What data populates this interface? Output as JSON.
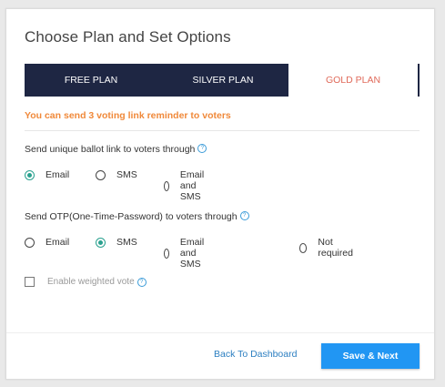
{
  "dialog": {
    "title": "Choose Plan and Set Options"
  },
  "plans": {
    "tabs": [
      {
        "label": "FREE PLAN"
      },
      {
        "label": "SILVER PLAN"
      },
      {
        "label": "GOLD PLAN"
      }
    ],
    "selected": "GOLD PLAN"
  },
  "notice": "You can send 3 voting link reminder to voters",
  "ballot": {
    "label": "Send unique ballot link to voters through",
    "help_icon": "help-circle-icon",
    "options": [
      "Email",
      "SMS",
      "Email and SMS"
    ],
    "selected": "Email"
  },
  "otp": {
    "label": "Send OTP(One-Time-Password) to voters through",
    "help_icon": "help-circle-icon",
    "options": [
      "Email",
      "SMS",
      "Email and SMS",
      "Not required"
    ],
    "selected": "SMS"
  },
  "weighted": {
    "label": "Enable weighted vote",
    "checked": false
  },
  "footer": {
    "back_label": "Back To Dashboard",
    "next_label": "Save & Next"
  },
  "colors": {
    "tab_dark": "#1e2643",
    "gold_text": "#e06a5a",
    "notice": "#f0893a",
    "radio_selected": "#2aa18f",
    "primary": "#2196f3",
    "link": "#2c7fc1"
  }
}
